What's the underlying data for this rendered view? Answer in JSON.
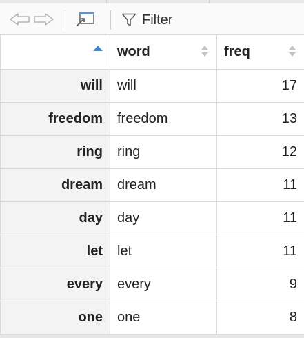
{
  "toolbar": {
    "filter_label": "Filter"
  },
  "table": {
    "columns": [
      "",
      "word",
      "freq"
    ],
    "rows": [
      {
        "name": "will",
        "word": "will",
        "freq": "17"
      },
      {
        "name": "freedom",
        "word": "freedom",
        "freq": "13"
      },
      {
        "name": "ring",
        "word": "ring",
        "freq": "12"
      },
      {
        "name": "dream",
        "word": "dream",
        "freq": "11"
      },
      {
        "name": "day",
        "word": "day",
        "freq": "11"
      },
      {
        "name": "let",
        "word": "let",
        "freq": "11"
      },
      {
        "name": "every",
        "word": "every",
        "freq": "9"
      },
      {
        "name": "one",
        "word": "one",
        "freq": "8"
      }
    ]
  },
  "colors": {
    "sort_active": "#3b8ad9",
    "sort_inactive": "#c4c4c4",
    "rowname_bg": "#f3f3f3",
    "border": "#d9d9d9"
  }
}
